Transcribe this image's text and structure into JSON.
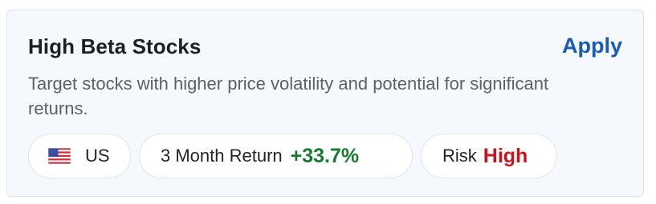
{
  "card": {
    "title": "High Beta Stocks",
    "apply_label": "Apply",
    "description": "Target stocks with higher price volatility and potential for significant returns."
  },
  "chips": {
    "country": {
      "icon": "us-flag-icon",
      "label": "US"
    },
    "return": {
      "label": "3 Month Return",
      "value": "+33.7%",
      "color": "#137a2e"
    },
    "risk": {
      "label": "Risk",
      "value": "High",
      "color": "#c8141e"
    }
  },
  "colors": {
    "accent": "#1a5bb5",
    "card_bg": "#f5f8fd",
    "border": "#dde3ea"
  }
}
